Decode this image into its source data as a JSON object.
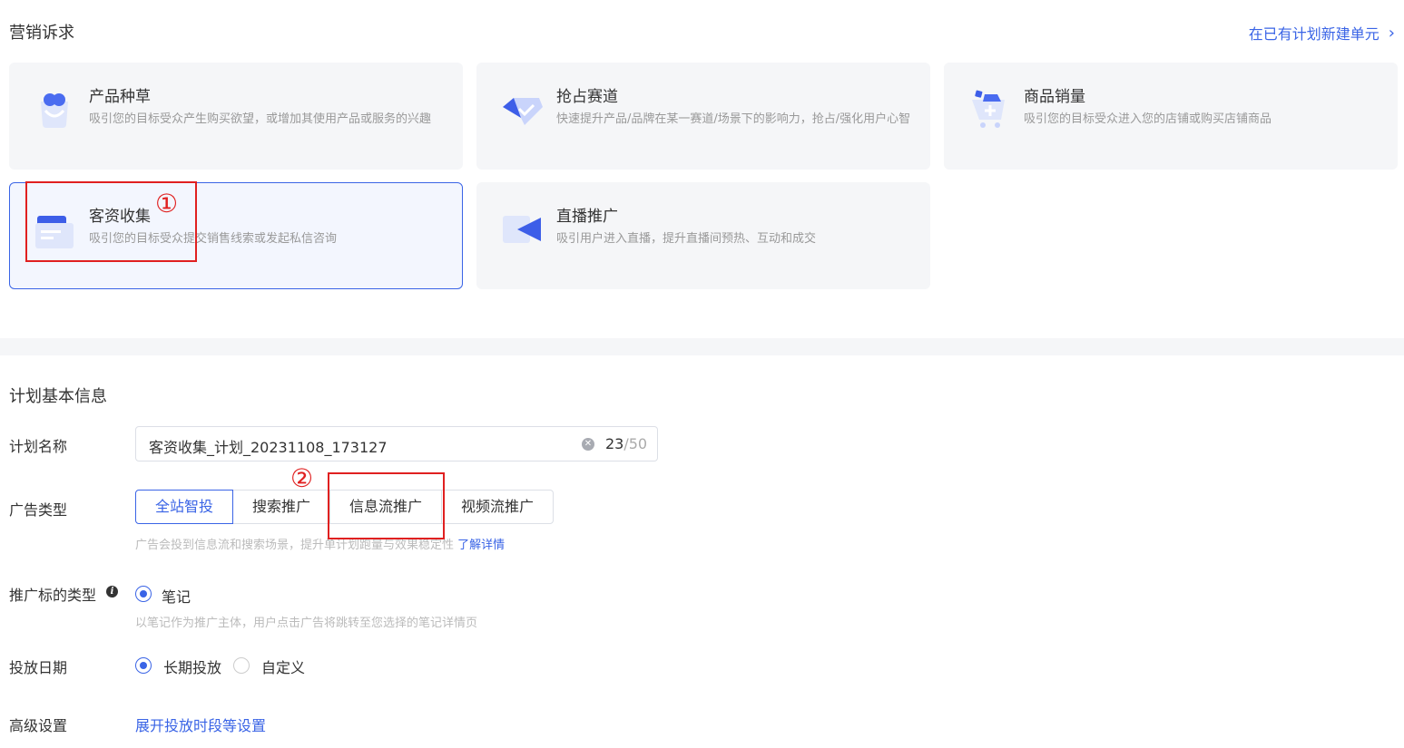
{
  "marketing": {
    "title": "营销诉求",
    "new_unit_link": "在已有计划新建单元",
    "chevron": "chevron-right-icon",
    "cards": [
      {
        "title": "产品种草",
        "desc": "吸引您的目标受众产生购买欲望，或增加其使用产品或服务的兴趣",
        "icon": "grass-bag-icon"
      },
      {
        "title": "抢占赛道",
        "desc": "快速提升产品/品牌在某一赛道/场景下的影响力，抢占/强化用户心智",
        "icon": "diamond-check-icon"
      },
      {
        "title": "商品销量",
        "desc": "吸引您的目标受众进入您的店铺或购买店铺商品",
        "icon": "shopping-cart-icon"
      },
      {
        "title": "客资收集",
        "desc": "吸引您的目标受众提交销售线索或发起私信咨询",
        "icon": "card-form-icon",
        "selected": true
      },
      {
        "title": "直播推广",
        "desc": "吸引用户进入直播，提升直播间预热、互动和成交",
        "icon": "video-camera-icon"
      }
    ]
  },
  "plan": {
    "title": "计划基本信息",
    "name_label": "计划名称",
    "name_value": "客资收集_计划_20231108_173127",
    "name_count": "23",
    "name_max": "/50",
    "ad_type_label": "广告类型",
    "ad_types": [
      "全站智投",
      "搜索推广",
      "信息流推广",
      "视频流推广"
    ],
    "ad_type_selected": "全站智投",
    "ad_type_hint": "广告会投到信息流和搜索场景，提升单计划跑量与效果稳定性",
    "ad_type_hint_link": "了解详情",
    "target_label": "推广标的类型",
    "target_option": "笔记",
    "target_hint": "以笔记作为推广主体，用户点击广告将跳转至您选择的笔记详情页",
    "date_label": "投放日期",
    "date_options": [
      "长期投放",
      "自定义"
    ],
    "date_selected": "长期投放",
    "advanced_label": "高级设置",
    "advanced_link": "展开投放时段等设置"
  },
  "annotations": [
    "①",
    "②"
  ],
  "colors": {
    "accent": "#3a64e6",
    "annotation": "#e02020",
    "card_bg": "#f5f6f8"
  }
}
